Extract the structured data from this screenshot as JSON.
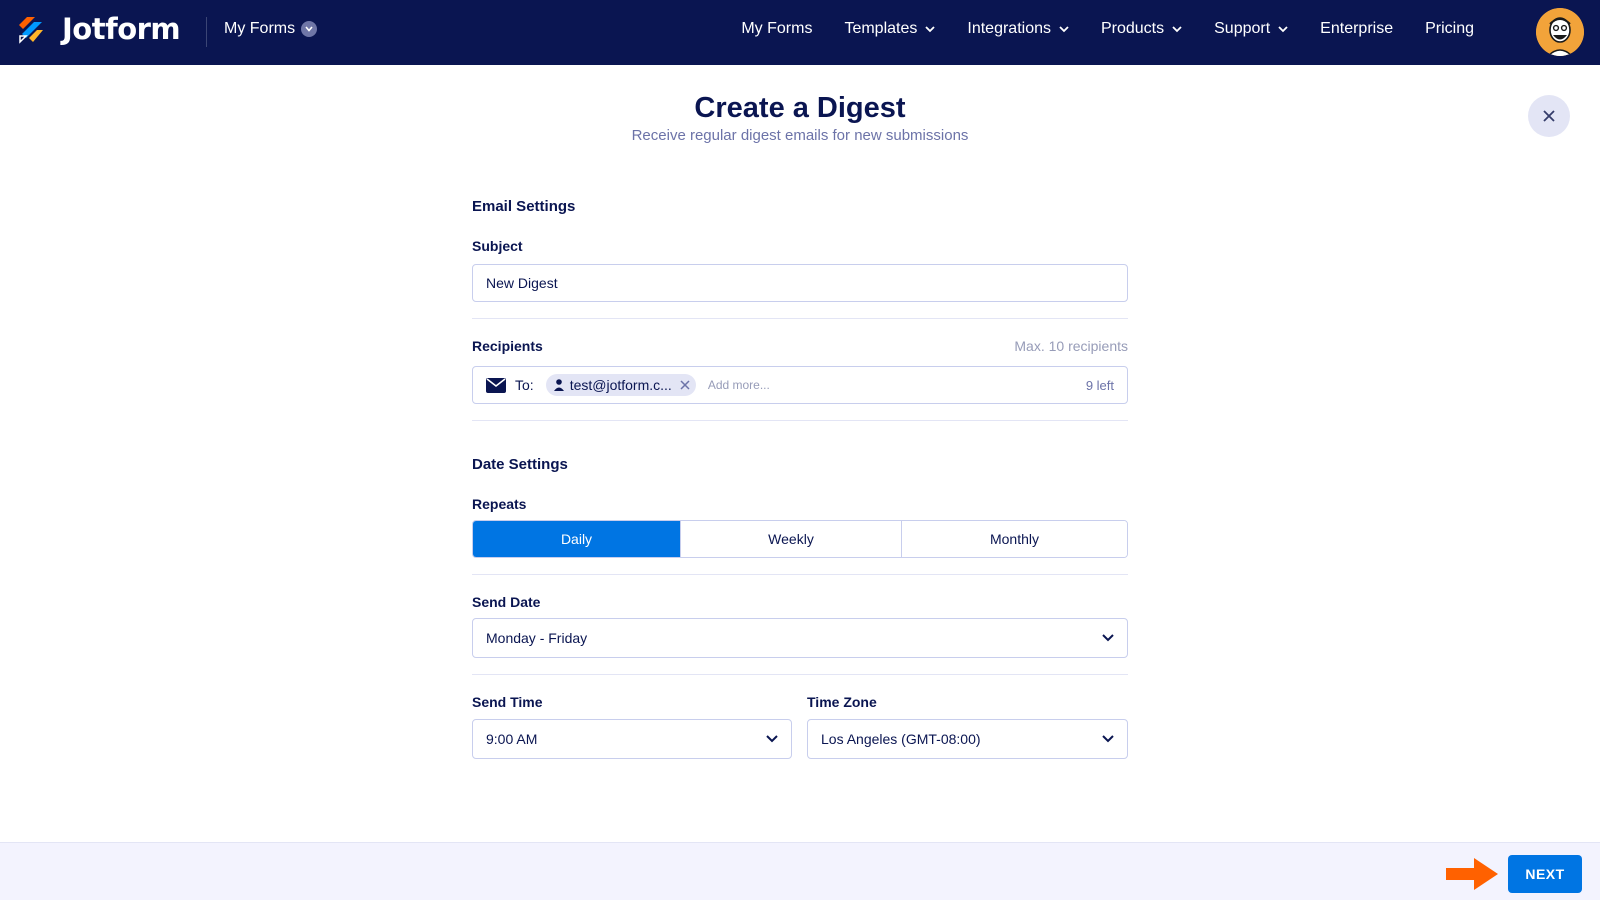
{
  "topbar": {
    "brand": "Jotform",
    "my_forms_switch": "My Forms",
    "nav": [
      {
        "label": "My Forms",
        "has_caret": false
      },
      {
        "label": "Templates",
        "has_caret": true
      },
      {
        "label": "Integrations",
        "has_caret": true
      },
      {
        "label": "Products",
        "has_caret": true
      },
      {
        "label": "Support",
        "has_caret": true
      },
      {
        "label": "Enterprise",
        "has_caret": false
      },
      {
        "label": "Pricing",
        "has_caret": false
      }
    ],
    "colors": {
      "background": "#0a1551",
      "logo_orange": "#ff6100",
      "logo_blue": "#0099ff",
      "logo_yellow": "#ffb629"
    }
  },
  "header": {
    "title": "Create a Digest",
    "subtitle": "Receive regular digest emails for new submissions",
    "close_icon": "close-icon"
  },
  "email_settings": {
    "section_title": "Email Settings",
    "subject_label": "Subject",
    "subject_value": "New Digest",
    "recipients_label": "Recipients",
    "recipients_hint": "Max. 10 recipients",
    "to_label": "To:",
    "recipient_chip": "test@jotform.c...",
    "add_more_placeholder": "Add more...",
    "remaining": "9 left"
  },
  "date_settings": {
    "section_title": "Date Settings",
    "repeats_label": "Repeats",
    "repeat_options": [
      "Daily",
      "Weekly",
      "Monthly"
    ],
    "repeat_selected": "Daily",
    "send_date_label": "Send Date",
    "send_date_value": "Monday - Friday",
    "send_time_label": "Send Time",
    "send_time_value": "9:00 AM",
    "time_zone_label": "Time Zone",
    "time_zone_value": "Los Angeles (GMT-08:00)"
  },
  "footer": {
    "next_label": "NEXT",
    "colors": {
      "primary": "#0075e3",
      "pointer": "#ff6100"
    }
  }
}
